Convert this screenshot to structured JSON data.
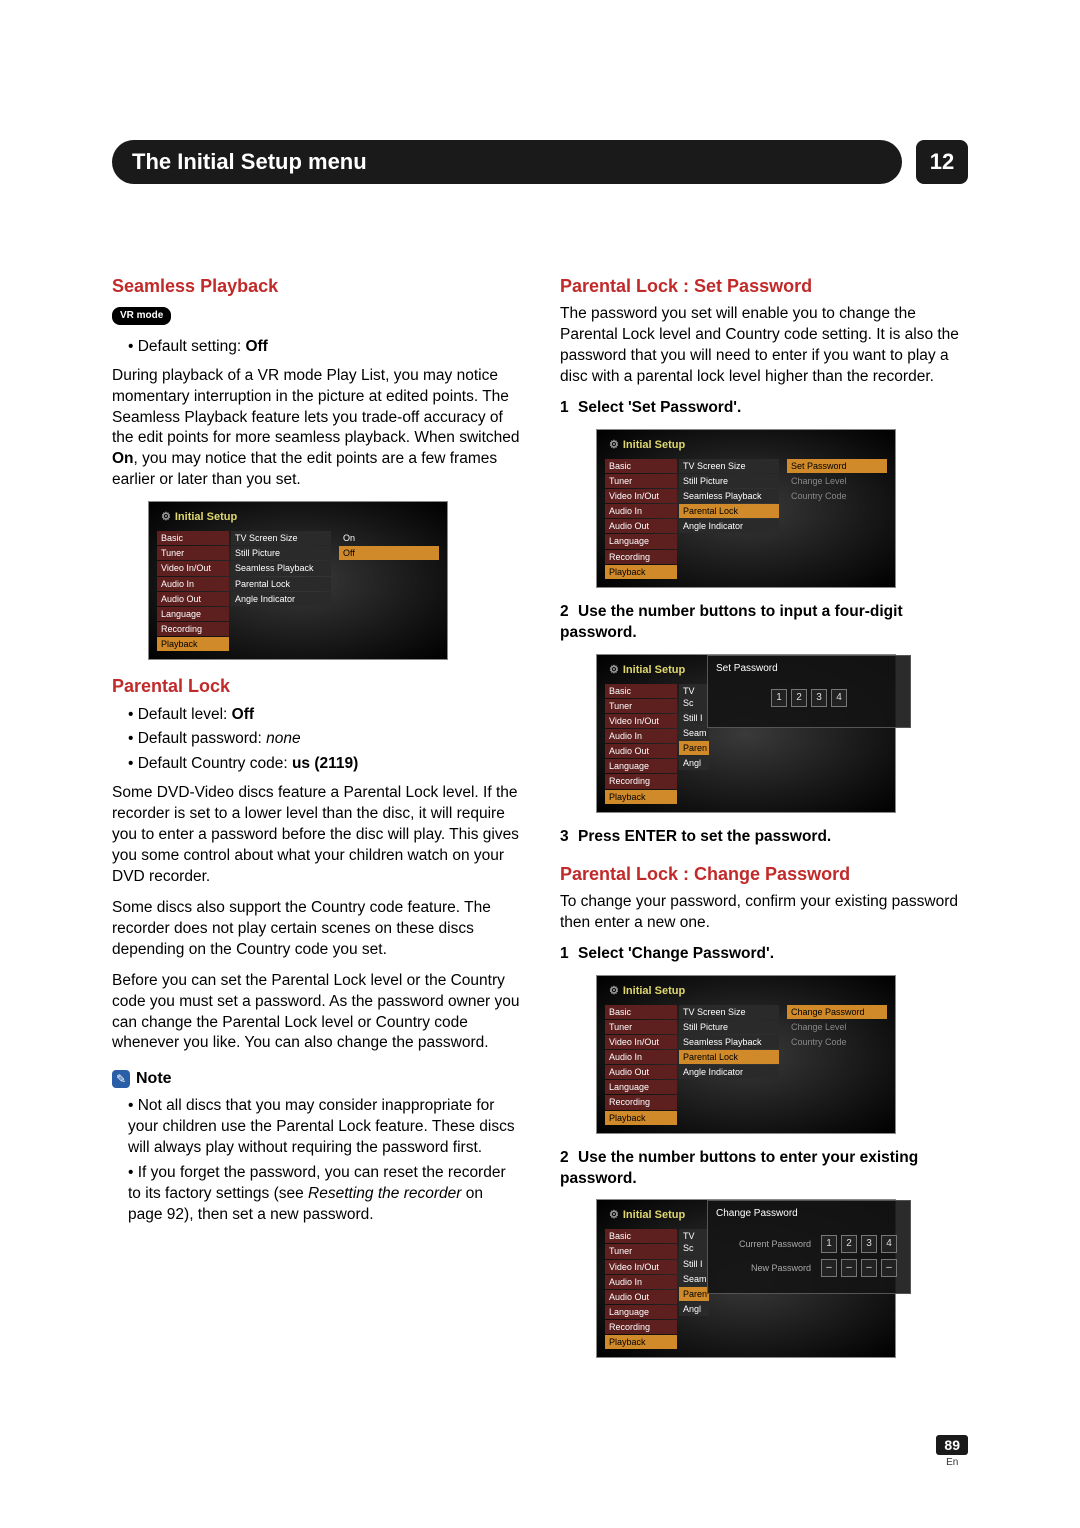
{
  "header": {
    "title": "The Initial Setup menu",
    "chapter": "12"
  },
  "left": {
    "seamless": {
      "heading": "Seamless Playback",
      "vr_badge": "VR mode",
      "default_setting_label": "Default setting: ",
      "default_setting_value": "Off",
      "para1_a": "During playback of a VR mode Play List, you may notice momentary interruption in the picture at edited points. The Seamless Playback feature lets you trade-off accuracy of the edit points for more seamless playback. When switched ",
      "para1_bold": "On",
      "para1_b": ", you may notice that the edit points are a few frames earlier or later than you set."
    },
    "parental": {
      "heading": "Parental Lock",
      "bul1_label": "Default level: ",
      "bul1_value": "Off",
      "bul2_label": "Default password: ",
      "bul2_value": "none",
      "bul3_label": "Default Country code: ",
      "bul3_value": "us (2119)",
      "para1": "Some DVD-Video discs feature a Parental Lock level. If the recorder is set to a lower level than the disc, it will require you to enter a password before the disc will play. This gives you some control about what your children watch on your DVD recorder.",
      "para2": "Some discs also support the Country code feature. The recorder does not play certain scenes on these discs depending on the Country code you set.",
      "para3": "Before you can set the Parental Lock level or the Country code you must set a password. As the password owner you can change the Parental Lock level or Country code whenever you like. You can also change the password."
    },
    "note": {
      "label": "Note",
      "n1": "Not all discs that you may consider inappropriate for your children use the Parental Lock feature. These discs will always play without requiring the password first.",
      "n2_a": "If you forget the password, you can reset the recorder to its factory settings (see ",
      "n2_i": "Resetting the recorder",
      "n2_b": " on page 92), then set a new password."
    }
  },
  "right": {
    "set": {
      "heading": "Parental Lock : Set Password",
      "para": "The password you set will enable you to change the Parental Lock level and Country code setting. It is also the password that you will need to enter if you want to play a disc with a parental lock level higher than the recorder.",
      "step1": "Select 'Set Password'.",
      "step2": "Use the number buttons to input a four-digit password.",
      "step3": "Press ENTER to set the password."
    },
    "change": {
      "heading": "Parental Lock : Change Password",
      "para": "To change your password, confirm your existing password then enter a new one.",
      "step1": "Select 'Change Password'.",
      "step2": "Use the number buttons to enter your existing password."
    }
  },
  "osd": {
    "title": "Initial Setup",
    "left_items": [
      "Basic",
      "Tuner",
      "Video In/Out",
      "Audio In",
      "Audio Out",
      "Language",
      "Recording",
      "Playback"
    ],
    "mid_items": [
      "TV Screen Size",
      "Still Picture",
      "Seamless Playback",
      "Parental Lock",
      "Angle Indicator"
    ],
    "mid_items_trunc": [
      "TV Sc",
      "Still I",
      "Seam",
      "Paren",
      "Angl"
    ],
    "seamless_right": {
      "on": "On",
      "off": "Off"
    },
    "set_password_items": [
      "Set Password",
      "Change Level",
      "Country Code"
    ],
    "change_password_items": [
      "Change Password",
      "Change Level",
      "Country Code"
    ],
    "dlg_set_title": "Set Password",
    "dlg_change_title": "Change Password",
    "current_pw": "Current Password",
    "new_pw": "New Password",
    "pin_set": [
      "1",
      "2",
      "3",
      "4"
    ],
    "pin_cur": [
      "1",
      "2",
      "3",
      "4"
    ],
    "pin_new": [
      "–",
      "–",
      "–",
      "–"
    ]
  },
  "footer": {
    "page": "89",
    "lang": "En"
  }
}
